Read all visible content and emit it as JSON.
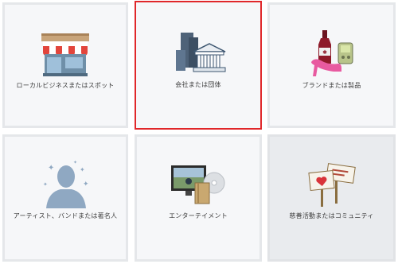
{
  "categories": [
    {
      "label": "ローカルビジネスまたはスポット",
      "icon": "storefront-icon"
    },
    {
      "label": "会社または団体",
      "icon": "company-building-icon"
    },
    {
      "label": "ブランドまたは製品",
      "icon": "brand-products-icon"
    },
    {
      "label": "アーティスト、バンドまたは著名人",
      "icon": "artist-silhouette-icon"
    },
    {
      "label": "エンターテイメント",
      "icon": "entertainment-media-icon"
    },
    {
      "label": "慈善活動またはコミュニティ",
      "icon": "community-signs-icon"
    }
  ],
  "selected_index": 1,
  "colors": {
    "selection_border": "#e0272a",
    "tile_bg": "#f6f7f9",
    "tile_border": "#e5e7ea"
  }
}
